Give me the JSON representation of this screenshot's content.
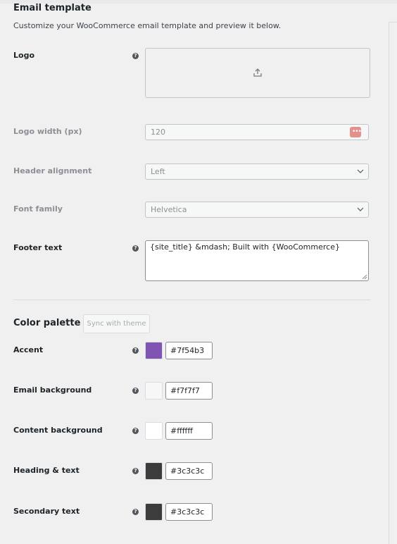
{
  "header": {
    "title": "Email template",
    "description": "Customize your WooCommerce email template and preview it below."
  },
  "fields": {
    "logo": {
      "label": "Logo",
      "help": "?",
      "upload_icon": "upload-icon"
    },
    "logo_width": {
      "label": "Logo width (px)",
      "value": "120",
      "badge_icon": "password-manager-icon"
    },
    "header_alignment": {
      "label": "Header alignment",
      "value": "Left"
    },
    "font_family": {
      "label": "Font family",
      "value": "Helvetica"
    },
    "footer_text": {
      "label": "Footer text",
      "help": "?",
      "value": "{site_title} &mdash; Built with {WooCommerce}"
    }
  },
  "palette": {
    "title": "Color palette",
    "sync_label": "Sync with theme",
    "colors": [
      {
        "label": "Accent",
        "help": "?",
        "value": "#7f54b3",
        "swatch": "#7f54b3"
      },
      {
        "label": "Email background",
        "help": "?",
        "value": "#f7f7f7",
        "swatch": "#f7f7f7"
      },
      {
        "label": "Content background",
        "help": "?",
        "value": "#ffffff",
        "swatch": "#ffffff"
      },
      {
        "label": "Heading & text",
        "help": "?",
        "value": "#3c3c3c",
        "swatch": "#3c3c3c"
      },
      {
        "label": "Secondary text",
        "help": "?",
        "value": "#3c3c3c",
        "swatch": "#3c3c3c"
      }
    ]
  }
}
